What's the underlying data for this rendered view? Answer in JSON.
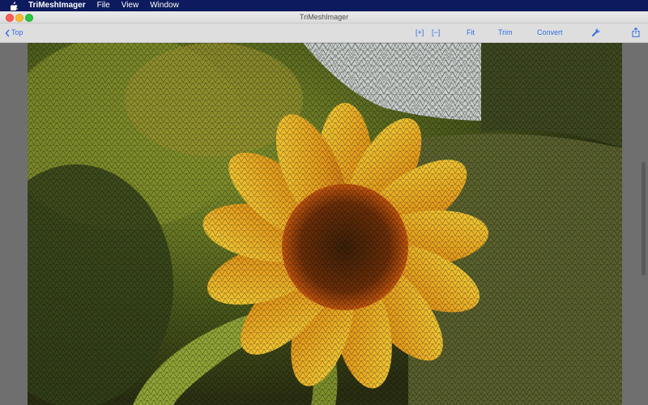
{
  "menubar": {
    "app_name": "TriMeshImager",
    "items": [
      "File",
      "View",
      "Window"
    ]
  },
  "window": {
    "title": "TriMeshImager"
  },
  "toolbar": {
    "back_label": "Top",
    "zoom_in_label": "[+]",
    "zoom_out_label": "[−]",
    "fit_label": "Fit",
    "trim_label": "Trim",
    "convert_label": "Convert"
  },
  "icons": {
    "apple": "apple-logo-icon",
    "back": "chevron-left-icon",
    "settings": "wrench-icon",
    "share": "share-icon"
  },
  "colors": {
    "menubar": "#0d1b5e",
    "accent": "#2f6ee8",
    "toolbar": "#dedede",
    "workspace": "#6f6f6f"
  }
}
